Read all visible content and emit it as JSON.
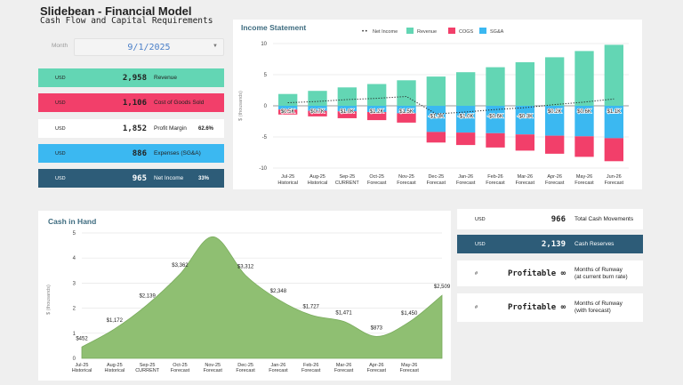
{
  "header": {
    "title": "Slidebean - Financial Model",
    "subtitle": "Cash Flow and Capital Requirements"
  },
  "month": {
    "label": "Month",
    "value": "9/1/2025",
    "icon": "chevron-down-icon"
  },
  "colors": {
    "revenue": "#63d6b4",
    "cogs": "#f23f6a",
    "sga": "#3bb8f1",
    "net": "#2d5c78",
    "cash": "#8fbf72",
    "title": "#3d6b7f"
  },
  "summary": [
    {
      "currency": "USD",
      "value": "2,958",
      "label": "Revenue",
      "pct": ""
    },
    {
      "currency": "USD",
      "value": "1,106",
      "label": "Cost of Goods Sold",
      "pct": ""
    },
    {
      "currency": "USD",
      "value": "1,852",
      "label": "Profit Margin",
      "pct": "62.6%"
    },
    {
      "currency": "USD",
      "value": "886",
      "label": "Expenses (SG&A)",
      "pct": ""
    },
    {
      "currency": "USD",
      "value": "965",
      "label": "Net Income",
      "pct": "33%"
    }
  ],
  "cash_summary": [
    {
      "currency": "USD",
      "value": "966",
      "label": "Total Cash Movements"
    },
    {
      "currency": "USD",
      "value": "2,139",
      "label": "Cash Reserves"
    },
    {
      "currency": "#",
      "value": "Profitable ∞",
      "label1": "Months of Runway",
      "label2": "(at current burn rate)"
    },
    {
      "currency": "#",
      "value": "Profitable ∞",
      "label1": "Months of Runway",
      "label2": "(with forecast)"
    }
  ],
  "chart_data": [
    {
      "type": "bar",
      "title": "Income Statement",
      "ylabel": "$ (thousands)",
      "ylim": [
        -10,
        10
      ],
      "yticks": [
        10,
        5,
        0,
        -5,
        -10
      ],
      "grid": true,
      "legend": "top",
      "categories": [
        [
          "Jul-25",
          "Historical"
        ],
        [
          "Aug-25",
          "Historical"
        ],
        [
          "Sep-25",
          "CURRENT"
        ],
        [
          "Oct-25",
          "Forecast"
        ],
        [
          "Nov-25",
          "Forecast"
        ],
        [
          "Dec-25",
          "Forecast"
        ],
        [
          "Jan-26",
          "Forecast"
        ],
        [
          "Feb-26",
          "Forecast"
        ],
        [
          "Mar-26",
          "Forecast"
        ],
        [
          "Apr-26",
          "Forecast"
        ],
        [
          "May-26",
          "Forecast"
        ],
        [
          "Jun-26",
          "Forecast"
        ]
      ],
      "series": [
        {
          "name": "Net Income",
          "type": "line",
          "values": [
            0.5,
            0.7,
            1.0,
            1.2,
            1.5,
            -1.3,
            -1.0,
            -0.6,
            -0.3,
            0.2,
            0.6,
            1.1
          ],
          "labels": [
            "$0.5K",
            "$0.7K",
            "$1.0K",
            "$1.2K",
            "$1.5K",
            "-$1.3K",
            "-$1.0K",
            "-$0.6K",
            "-$0.3K",
            "$0.2K",
            "$0.6K",
            "$1.1K"
          ]
        },
        {
          "name": "Revenue",
          "values": [
            1.9,
            2.4,
            2.958,
            3.5,
            4.1,
            4.7,
            5.4,
            6.2,
            7.0,
            7.8,
            8.8,
            9.8
          ]
        },
        {
          "name": "COGS",
          "values": [
            -0.8,
            -0.9,
            -1.106,
            -1.3,
            -1.5,
            -1.7,
            -2.0,
            -2.3,
            -2.6,
            -2.9,
            -3.3,
            -3.7
          ]
        },
        {
          "name": "SG&A",
          "values": [
            -0.6,
            -0.8,
            -0.886,
            -1.0,
            -1.2,
            -4.2,
            -4.3,
            -4.4,
            -4.6,
            -4.8,
            -4.9,
            -5.2
          ]
        }
      ]
    },
    {
      "type": "area",
      "title": "Cash in Hand",
      "ylabel": "$ (thousands)",
      "ylim": [
        0,
        5
      ],
      "yticks": [
        0,
        1,
        2,
        3,
        4,
        5
      ],
      "grid": true,
      "categories": [
        [
          "Jul-25",
          "Historical"
        ],
        [
          "Aug-25",
          "Historical"
        ],
        [
          "Sep-25",
          "CURRENT"
        ],
        [
          "Oct-25",
          "Forecast"
        ],
        [
          "Nov-25",
          "Forecast"
        ],
        [
          "Dec-25",
          "Forecast"
        ],
        [
          "Jan-26",
          "Forecast"
        ],
        [
          "Feb-26",
          "Forecast"
        ],
        [
          "Mar-26",
          "Forecast"
        ],
        [
          "Apr-26",
          "Forecast"
        ],
        [
          "May-26",
          "Forecast"
        ],
        [
          "",
          ""
        ]
      ],
      "values": [
        0.452,
        1.172,
        2.139,
        3.362,
        4.85,
        3.312,
        2.348,
        1.727,
        1.471,
        0.873,
        1.45,
        2.509
      ],
      "labels": [
        "$452",
        "$1,172",
        "$2,139",
        "$3,362",
        "",
        "$3,312",
        "$2,348",
        "$1,727",
        "$1,471",
        "$873",
        "$1,450",
        "$2,509"
      ]
    }
  ]
}
